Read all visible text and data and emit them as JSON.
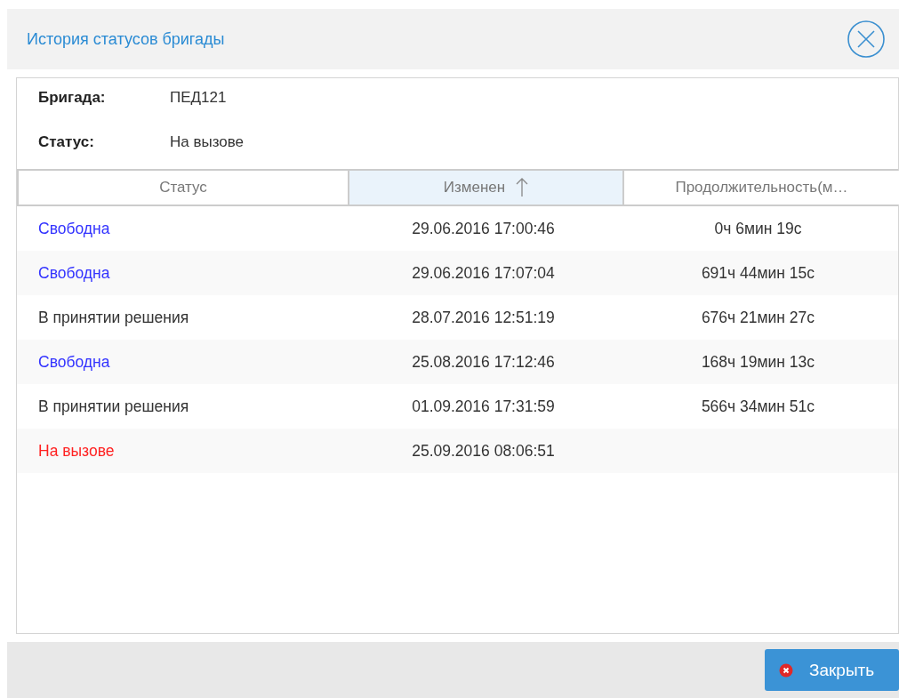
{
  "dialog": {
    "title": "История статусов бригады"
  },
  "info": [
    {
      "label": "Бригада:",
      "value": "ПЕД121"
    },
    {
      "label": "Статус:",
      "value": "На вызове"
    }
  ],
  "table": {
    "columns": [
      {
        "label": "Статус",
        "sorted": false
      },
      {
        "label": "Изменен",
        "sorted": true
      },
      {
        "label": "Продолжительность(м…",
        "sorted": false
      }
    ],
    "rows": [
      {
        "status": "Свободна",
        "color": "#3333ff",
        "changed": "29.06.2016 17:00:46",
        "duration": "0ч 6мин 19с"
      },
      {
        "status": "Свободна",
        "color": "#3333ff",
        "changed": "29.06.2016 17:07:04",
        "duration": "691ч 44мин 15с"
      },
      {
        "status": "В принятии решения",
        "color": "#333333",
        "changed": "28.07.2016 12:51:19",
        "duration": "676ч 21мин 27с"
      },
      {
        "status": "Свободна",
        "color": "#3333ff",
        "changed": "25.08.2016 17:12:46",
        "duration": "168ч 19мин 13с"
      },
      {
        "status": "В принятии решения",
        "color": "#333333",
        "changed": "01.09.2016 17:31:59",
        "duration": "566ч 34мин 51с"
      },
      {
        "status": "На вызове",
        "color": "#ff2222",
        "changed": "25.09.2016 08:06:51",
        "duration": ""
      }
    ]
  },
  "buttons": [
    {
      "label": "Закрыть"
    }
  ]
}
